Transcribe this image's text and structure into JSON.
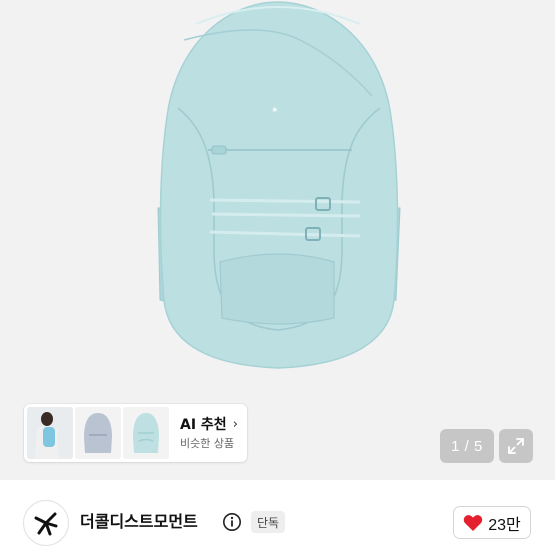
{
  "ai_recommend": {
    "title": "AI 추천",
    "chevron": "›",
    "subtitle": "비슷한 상품"
  },
  "gallery": {
    "counter": "1 / 5"
  },
  "store": {
    "name": "더콜디스트모먼트",
    "badge": "단독",
    "likes": "23만"
  },
  "colors": {
    "hero_bg": "#f2f2f2",
    "bag": "#bcdfe2",
    "like_heart": "#e5202e"
  },
  "icons": [
    "info-icon",
    "expand-icon",
    "heart-icon",
    "brand-logo"
  ]
}
